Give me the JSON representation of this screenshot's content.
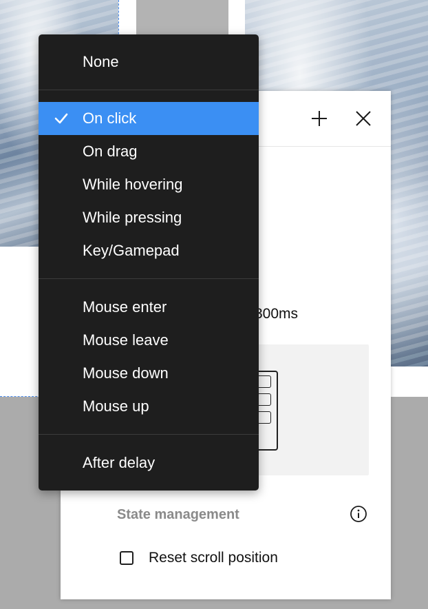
{
  "trigger_menu": {
    "groups": [
      [
        {
          "label": "None",
          "selected": false
        }
      ],
      [
        {
          "label": "On click",
          "selected": true
        },
        {
          "label": "On drag",
          "selected": false
        },
        {
          "label": "While hovering",
          "selected": false
        },
        {
          "label": "While pressing",
          "selected": false
        },
        {
          "label": "Key/Gamepad",
          "selected": false
        }
      ],
      [
        {
          "label": "Mouse enter",
          "selected": false
        },
        {
          "label": "Mouse leave",
          "selected": false
        },
        {
          "label": "Mouse down",
          "selected": false
        },
        {
          "label": "Mouse up",
          "selected": false
        }
      ],
      [
        {
          "label": "After delay",
          "selected": false
        }
      ]
    ],
    "selected_color": "#3b8ff3",
    "background_color": "#1e1e1e"
  },
  "panel": {
    "header_icons": [
      "plus-icon",
      "close-icon"
    ],
    "duration_text": "300ms",
    "state_management_label": "State management",
    "state_management_icon": "info-icon",
    "reset_scroll": {
      "label": "Reset scroll position",
      "checked": false
    }
  }
}
